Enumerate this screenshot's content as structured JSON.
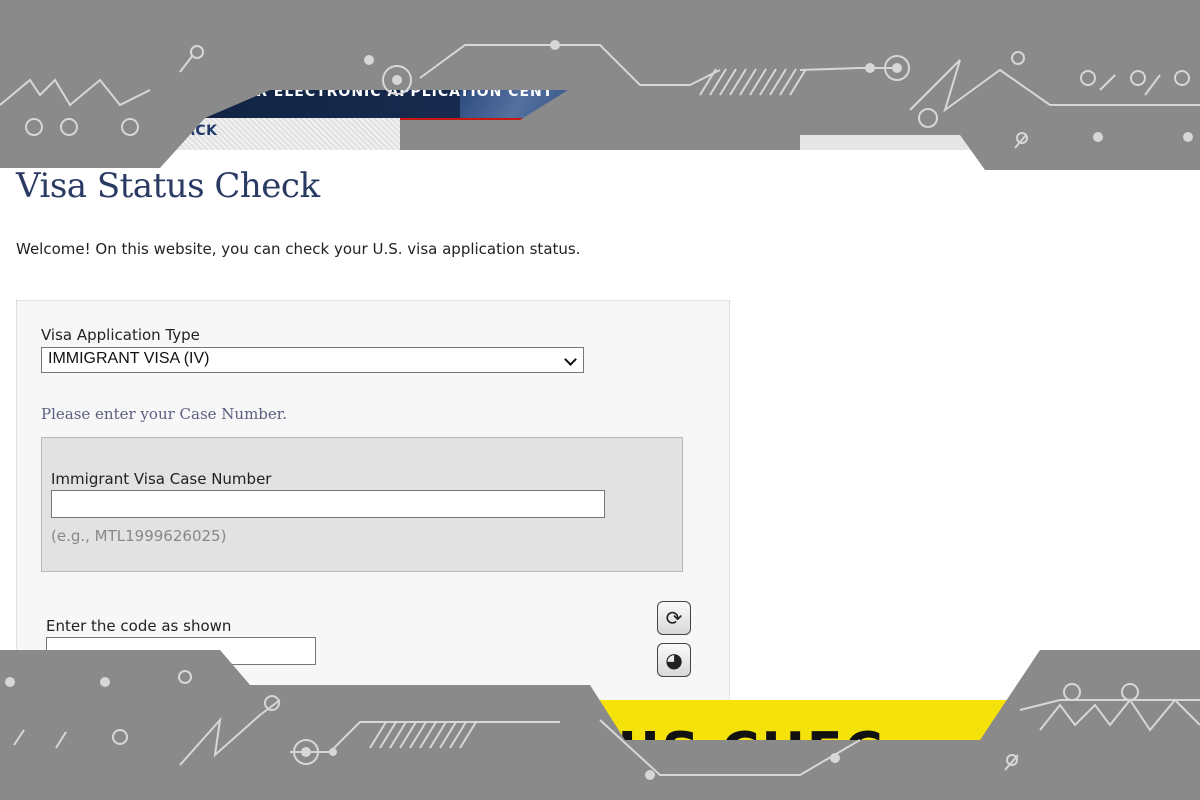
{
  "header": {
    "banner_title": "ULAR ELECTRONIC APPLICATION CENT",
    "nav_back_label": "ACK",
    "nav_active_label": "VISA STATUS CHECK"
  },
  "page": {
    "title": "Visa Status Check",
    "welcome": "Welcome! On this website, you can check your U.S. visa application status."
  },
  "form": {
    "app_type_label": "Visa Application Type",
    "app_type_value": "IMMIGRANT VISA (IV)",
    "prompt": "Please enter your Case Number.",
    "case_label": "Immigrant Visa Case Number",
    "case_value": "",
    "case_example": "(e.g., MTL1999626025)",
    "captcha_label": "Enter the code as shown",
    "captcha_value": ""
  },
  "overlay": {
    "yellow_text": "TUS CHEC"
  },
  "icons": {
    "refresh": "refresh-icon",
    "audio": "audio-icon"
  },
  "colors": {
    "nav_active": "#c8170f",
    "title": "#2a3a63",
    "overlay_gray": "#8a8a8a",
    "overlay_yellow": "#f5e20a"
  }
}
